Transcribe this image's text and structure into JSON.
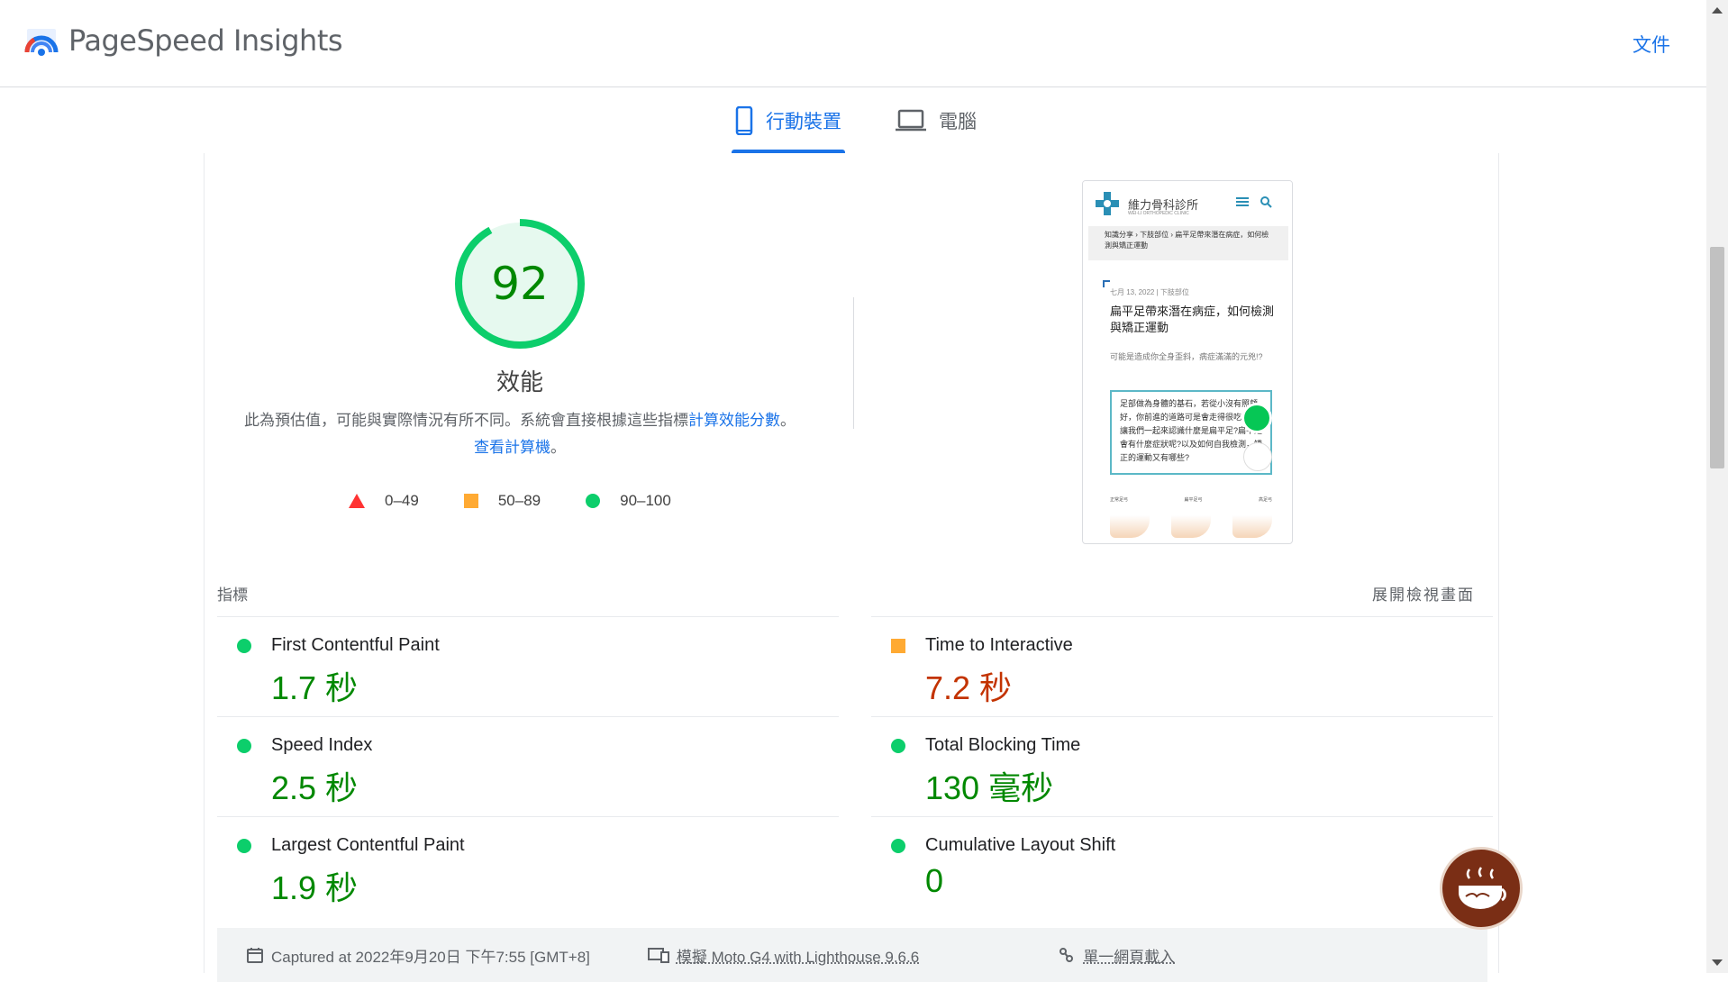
{
  "header": {
    "brand": "PageSpeed Insights",
    "docs_link": "文件"
  },
  "tabs": [
    {
      "label": "行動裝置",
      "icon": "smartphone-icon",
      "active": true
    },
    {
      "label": "電腦",
      "icon": "laptop-icon",
      "active": false
    }
  ],
  "score": {
    "value": "92",
    "fraction": 0.92,
    "label": "效能",
    "color": "#0cce6b"
  },
  "description": {
    "text": "此為預估值，可能與實際情況有所不同。系統會直接根據這些指標",
    "link1": "計算效能分數",
    "mid": "。",
    "link2": "查看計算機",
    "end": "。"
  },
  "legend": [
    {
      "range": "0–49",
      "shape": "triangle",
      "color": "#ff3333"
    },
    {
      "range": "50–89",
      "shape": "square",
      "color": "#ffaa33"
    },
    {
      "range": "90–100",
      "shape": "circle",
      "color": "#0cce6b"
    }
  ],
  "preview": {
    "site_name": "維力骨科診所",
    "site_sub": "WEI-LI ORTHOPEDIC CLINIC",
    "breadcrumb": "知識分享 › 下肢部位 › 扁平足帶來潛在病症，如何檢測與矯正運動",
    "date": "七月 13, 2022 | 下肢部位",
    "title": "扁平足帶來潛在病症，如何檢測與矯正運動",
    "excerpt": "可能是造成你全身歪斜，病症滿滿的元兇!?",
    "box_text": "足部做為身體的基石，若從小沒有照顧好，你前進的道路可是會走得很吃力喔!讓我們一起來認識什麼是扁平足?扁平足會有什麼症狀呢?以及如何自我檢測，矯正的運動又有哪些?",
    "foot_labels": [
      "正常足弓",
      "扁平足弓",
      "高足弓"
    ]
  },
  "metrics_section": {
    "title": "指標",
    "expand": "展開檢視畫面"
  },
  "metrics": [
    {
      "name": "First Contentful Paint",
      "value": "1.7 秒",
      "status": "pass"
    },
    {
      "name": "Time to Interactive",
      "value": "7.2 秒",
      "status": "average"
    },
    {
      "name": "Speed Index",
      "value": "2.5 秒",
      "status": "pass"
    },
    {
      "name": "Total Blocking Time",
      "value": "130 毫秒",
      "status": "pass"
    },
    {
      "name": "Largest Contentful Paint",
      "value": "1.9 秒",
      "status": "pass"
    },
    {
      "name": "Cumulative Layout Shift",
      "value": "0",
      "status": "pass"
    }
  ],
  "footer": {
    "captured": "Captured at 2022年9月20日 下午7:55 [GMT+8]",
    "device": "模擬 Moto G4 with Lighthouse 9.6.6",
    "load": "單一網頁載入"
  },
  "colors": {
    "accent": "#1a73e8",
    "pass": "#0cce6b",
    "average": "#ffaa33",
    "fail": "#ff3333"
  }
}
